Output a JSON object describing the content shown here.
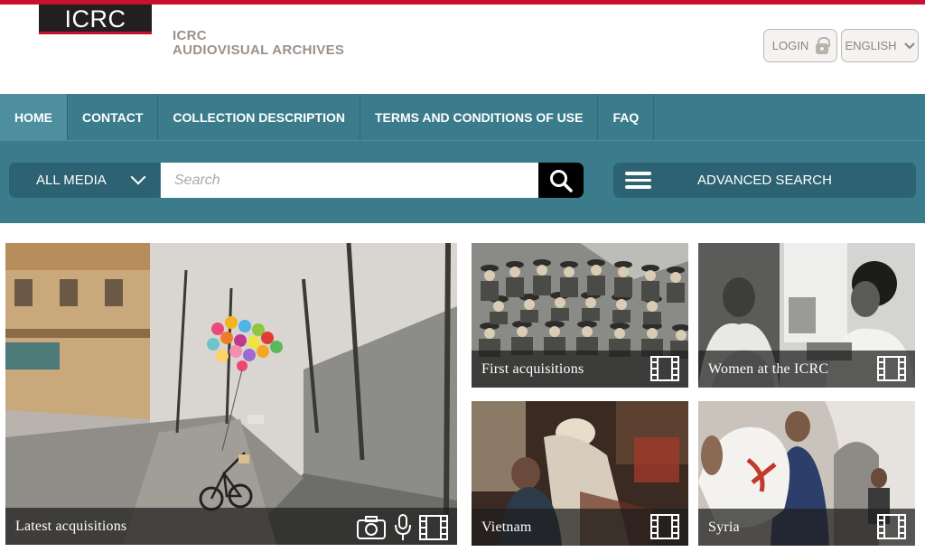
{
  "header": {
    "logo_text": "ICRC",
    "site_name_line1": "ICRC",
    "site_name_line2": "AUDIOVISUAL ARCHIVES",
    "login_label": "LOGIN",
    "language_label": "ENGLISH"
  },
  "nav": {
    "items": [
      {
        "label": "HOME"
      },
      {
        "label": "CONTACT"
      },
      {
        "label": "COLLECTION DESCRIPTION"
      },
      {
        "label": "TERMS AND CONDITIONS OF USE"
      },
      {
        "label": "FAQ"
      }
    ]
  },
  "search": {
    "media_filter": "ALL MEDIA",
    "placeholder": "Search",
    "advanced_label": "ADVANCED SEARCH"
  },
  "tiles": [
    {
      "caption": "Latest acquisitions",
      "icons": [
        "camera-icon",
        "microphone-icon",
        "film-icon"
      ]
    },
    {
      "caption": "First acquisitions",
      "icons": [
        "film-icon"
      ]
    },
    {
      "caption": "Women at the ICRC",
      "icons": [
        "film-icon"
      ]
    },
    {
      "caption": "Vietnam",
      "icons": [
        "film-icon"
      ]
    },
    {
      "caption": "Syria",
      "icons": [
        "film-icon"
      ]
    }
  ],
  "colors": {
    "accent_red": "#c8102e",
    "nav_teal": "#3a7c8b",
    "control_dark_teal": "#2c6271"
  }
}
